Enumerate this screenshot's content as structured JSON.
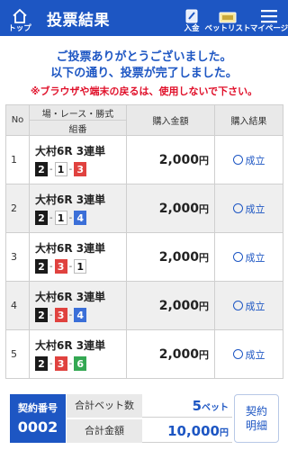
{
  "header": {
    "home_label": "トップ",
    "title": "投票結果",
    "deposit_label": "入金",
    "betlist_label": "ベットリスト",
    "mypage_label": "マイページ"
  },
  "messages": {
    "thanks": "ご投票ありがとうございました。",
    "complete": "以下の通り、投票が完了しました。",
    "warning": "※ブラウザや端末の戻るは、使用しないで下さい。"
  },
  "table": {
    "col_no": "No",
    "col_race": "場・レース・勝式",
    "col_race_sub": "組番",
    "col_amount": "購入金額",
    "col_result": "購入結果",
    "rows": [
      {
        "no": "1",
        "race": "大村6R 3連単",
        "c1": "2",
        "c2": "1",
        "c3": "3",
        "amount": "2,000",
        "yen": "円",
        "result": "成立"
      },
      {
        "no": "2",
        "race": "大村6R 3連単",
        "c1": "2",
        "c2": "1",
        "c3": "4",
        "amount": "2,000",
        "yen": "円",
        "result": "成立"
      },
      {
        "no": "3",
        "race": "大村6R 3連単",
        "c1": "2",
        "c2": "3",
        "c3": "1",
        "amount": "2,000",
        "yen": "円",
        "result": "成立"
      },
      {
        "no": "4",
        "race": "大村6R 3連単",
        "c1": "2",
        "c2": "3",
        "c3": "4",
        "amount": "2,000",
        "yen": "円",
        "result": "成立"
      },
      {
        "no": "5",
        "race": "大村6R 3連単",
        "c1": "2",
        "c2": "3",
        "c3": "6",
        "amount": "2,000",
        "yen": "円",
        "result": "成立"
      }
    ]
  },
  "footer": {
    "record_label": "契約番号",
    "record_no": "0002",
    "total_bets_label": "合計ベット数",
    "total_bets": "5",
    "total_bets_unit": "ベット",
    "total_amount_label": "合計金額",
    "total_amount": "10,000",
    "total_amount_unit": "円",
    "detail_line1": "契約",
    "detail_line2": "明細"
  },
  "boat_colors": {
    "1": {
      "bg": "#ffffff",
      "fg": "#111111",
      "border": "#bbbbbb"
    },
    "2": {
      "bg": "#1a1a1a",
      "fg": "#ffffff",
      "border": "#1a1a1a"
    },
    "3": {
      "bg": "#e0423f",
      "fg": "#ffffff",
      "border": "#e0423f"
    },
    "4": {
      "bg": "#3b6fd8",
      "fg": "#ffffff",
      "border": "#3b6fd8"
    },
    "6": {
      "bg": "#34a853",
      "fg": "#ffffff",
      "border": "#34a853"
    }
  },
  "accent": "#1d56c3"
}
